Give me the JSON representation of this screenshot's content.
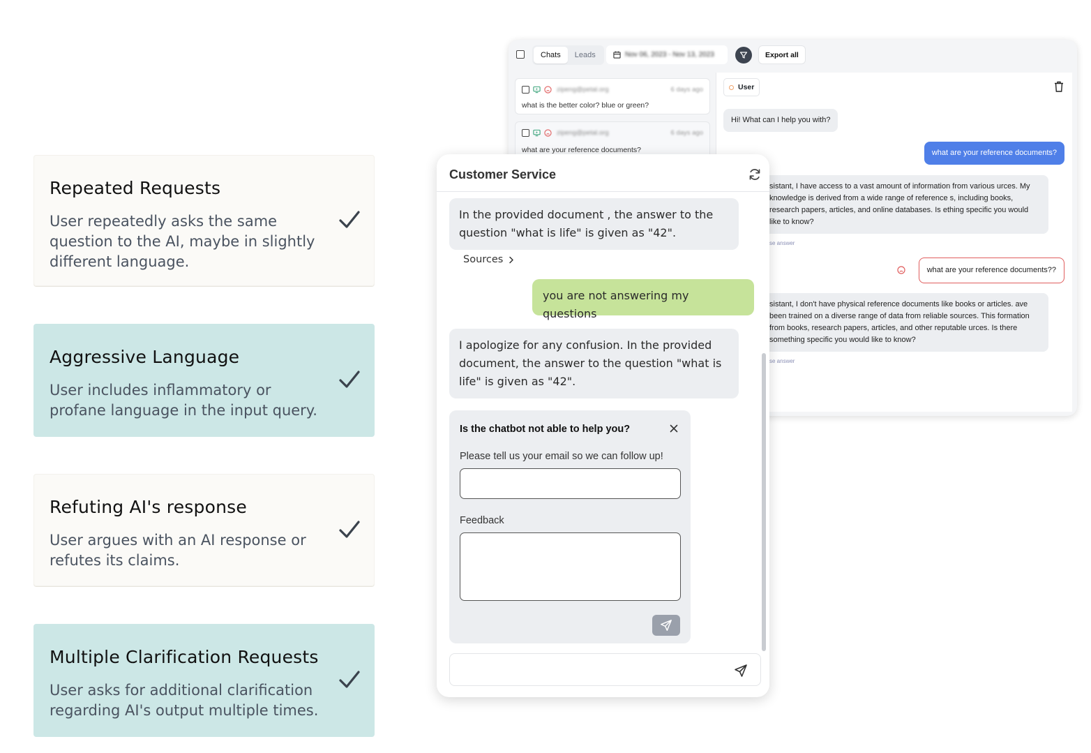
{
  "cards": [
    {
      "title": "Repeated Requests",
      "desc": "User repeatedly asks the same question to the AI, maybe in slightly different language."
    },
    {
      "title": "Aggressive Language",
      "desc": "User includes inflammatory or profane language in the input query."
    },
    {
      "title": "Refuting AI's response",
      "desc": "User argues with an AI response or refutes its claims."
    },
    {
      "title": "Multiple Clarification Requests",
      "desc": "User asks for additional clarification regarding AI's output multiple times."
    }
  ],
  "admin": {
    "tabs": [
      "Chats",
      "Leads"
    ],
    "date_range": "Nov 06, 2023 - Nov 13, 2023",
    "export_label": "Export all",
    "list": [
      {
        "email": "zipeng@petal.org",
        "time": "6 days ago",
        "message": "what is the better color? blue or green?"
      },
      {
        "email": "zipeng@petal.org",
        "time": "6 days ago",
        "message": "what are your reference documents?"
      }
    ],
    "user_chip": "User",
    "conversation": {
      "greeting": "Hi! What can I help you with?",
      "user_msg_1": "what are your reference documents?",
      "bot_reply_1": "sistant, I have access to a vast amount of information from various urces. My knowledge is derived from a wide range of reference s, including books, research papers, articles, and online databases. Is ething specific you would like to know?",
      "link_1": "se answer",
      "user_msg_2": "what are your reference documents??",
      "bot_reply_2": "sistant, I don't have physical reference documents like books or articles. ave been trained on a diverse range of data from reliable sources. This formation from books, research papers, articles, and other reputable urces. Is there something specific you would like to know?",
      "link_2": "se answer"
    }
  },
  "widget": {
    "title": "Customer Service",
    "bot_msg_1": "In the provided document , the answer to the question \"what is life\" is given as \"42\".",
    "sources_label": "Sources",
    "user_msg": "you are not answering my questions",
    "bot_msg_2": "I apologize for any confusion. In the provided document, the answer to the question \"what is life\" is given as \"42\".",
    "form": {
      "title": "Is the chatbot not able to help you?",
      "email_prompt": "Please tell us your email so we can follow up!",
      "feedback_label": "Feedback"
    }
  },
  "colors": {
    "teal_card": "#cce7e6",
    "light_card": "#fbfaf7",
    "user_bubble_green": "#c6e39a",
    "admin_user_bubble": "#4f7fe8",
    "flag_red": "#e05d5d"
  }
}
